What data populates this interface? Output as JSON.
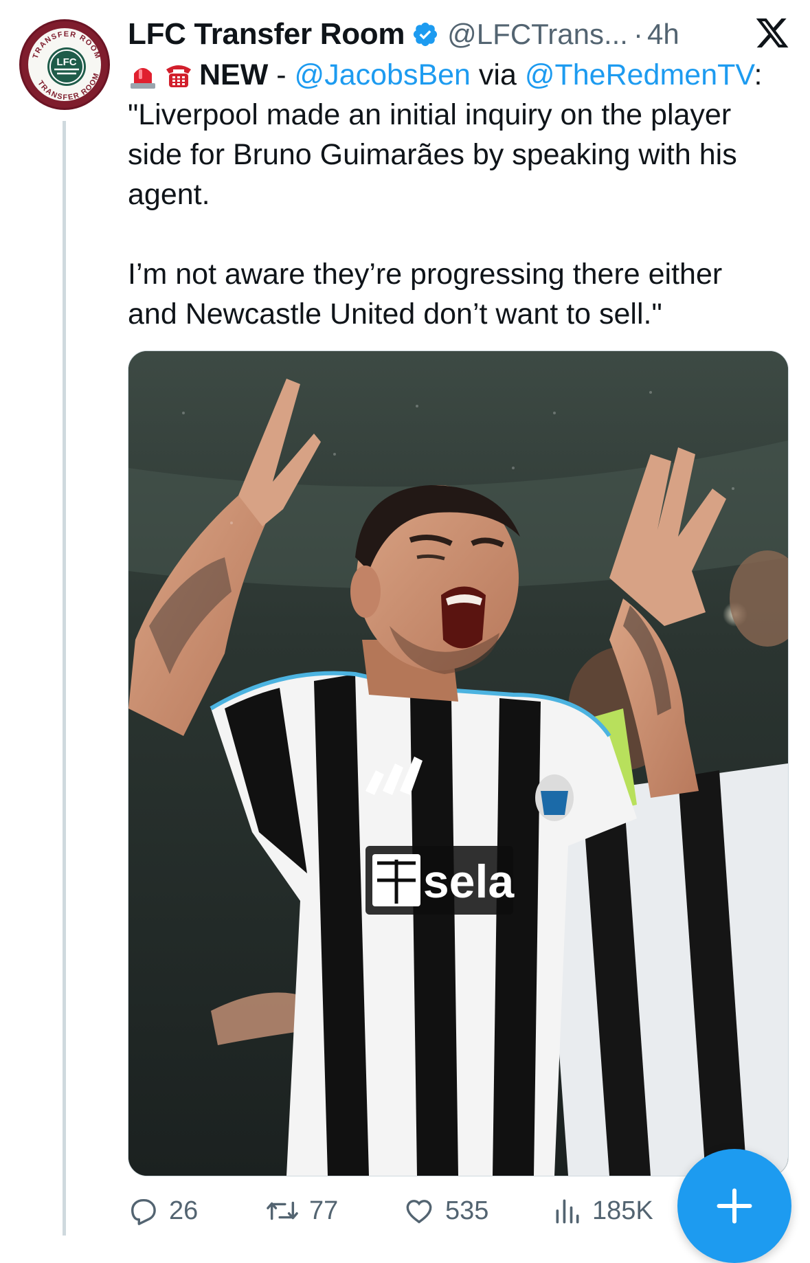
{
  "account": {
    "display_name": "LFC Transfer Room",
    "handle": "@LFCTrans...",
    "separator": "·",
    "time": "4h",
    "avatar_ring_text": "TRANSFER ROOM",
    "avatar_logo_text": "LFC",
    "verified": true
  },
  "platform_logo": "x-logo",
  "tweet": {
    "emojis": [
      "rotating-light-emoji",
      "telephone-emoji"
    ],
    "new_label": "NEW",
    "dash": " - ",
    "mention_author": "@JacobsBen",
    "via": " via ",
    "mention_outlet": "@TheRedmenTV",
    "colon": ":",
    "quote_line_1": "\"Liverpool made an initial inquiry on the player",
    "quote_line_2": "side for Bruno Guimarães by speaking with his",
    "quote_line_3": "agent.",
    "quote_line_4": "I’m not aware they’re progressing there either",
    "quote_line_5": "and Newcastle United don’t want to sell.\""
  },
  "media": {
    "description_icon": "photo",
    "shirt_sponsor": "sela"
  },
  "actions": {
    "replies": "26",
    "reposts": "77",
    "likes": "535",
    "views": "185K"
  },
  "compose_button": "+",
  "colors": {
    "link": "#1d9bf0",
    "secondary_text": "#536471",
    "avatar_ring": "#7f1d2d",
    "avatar_logo": "#1f5c4a",
    "fab": "#1d9bf0"
  }
}
